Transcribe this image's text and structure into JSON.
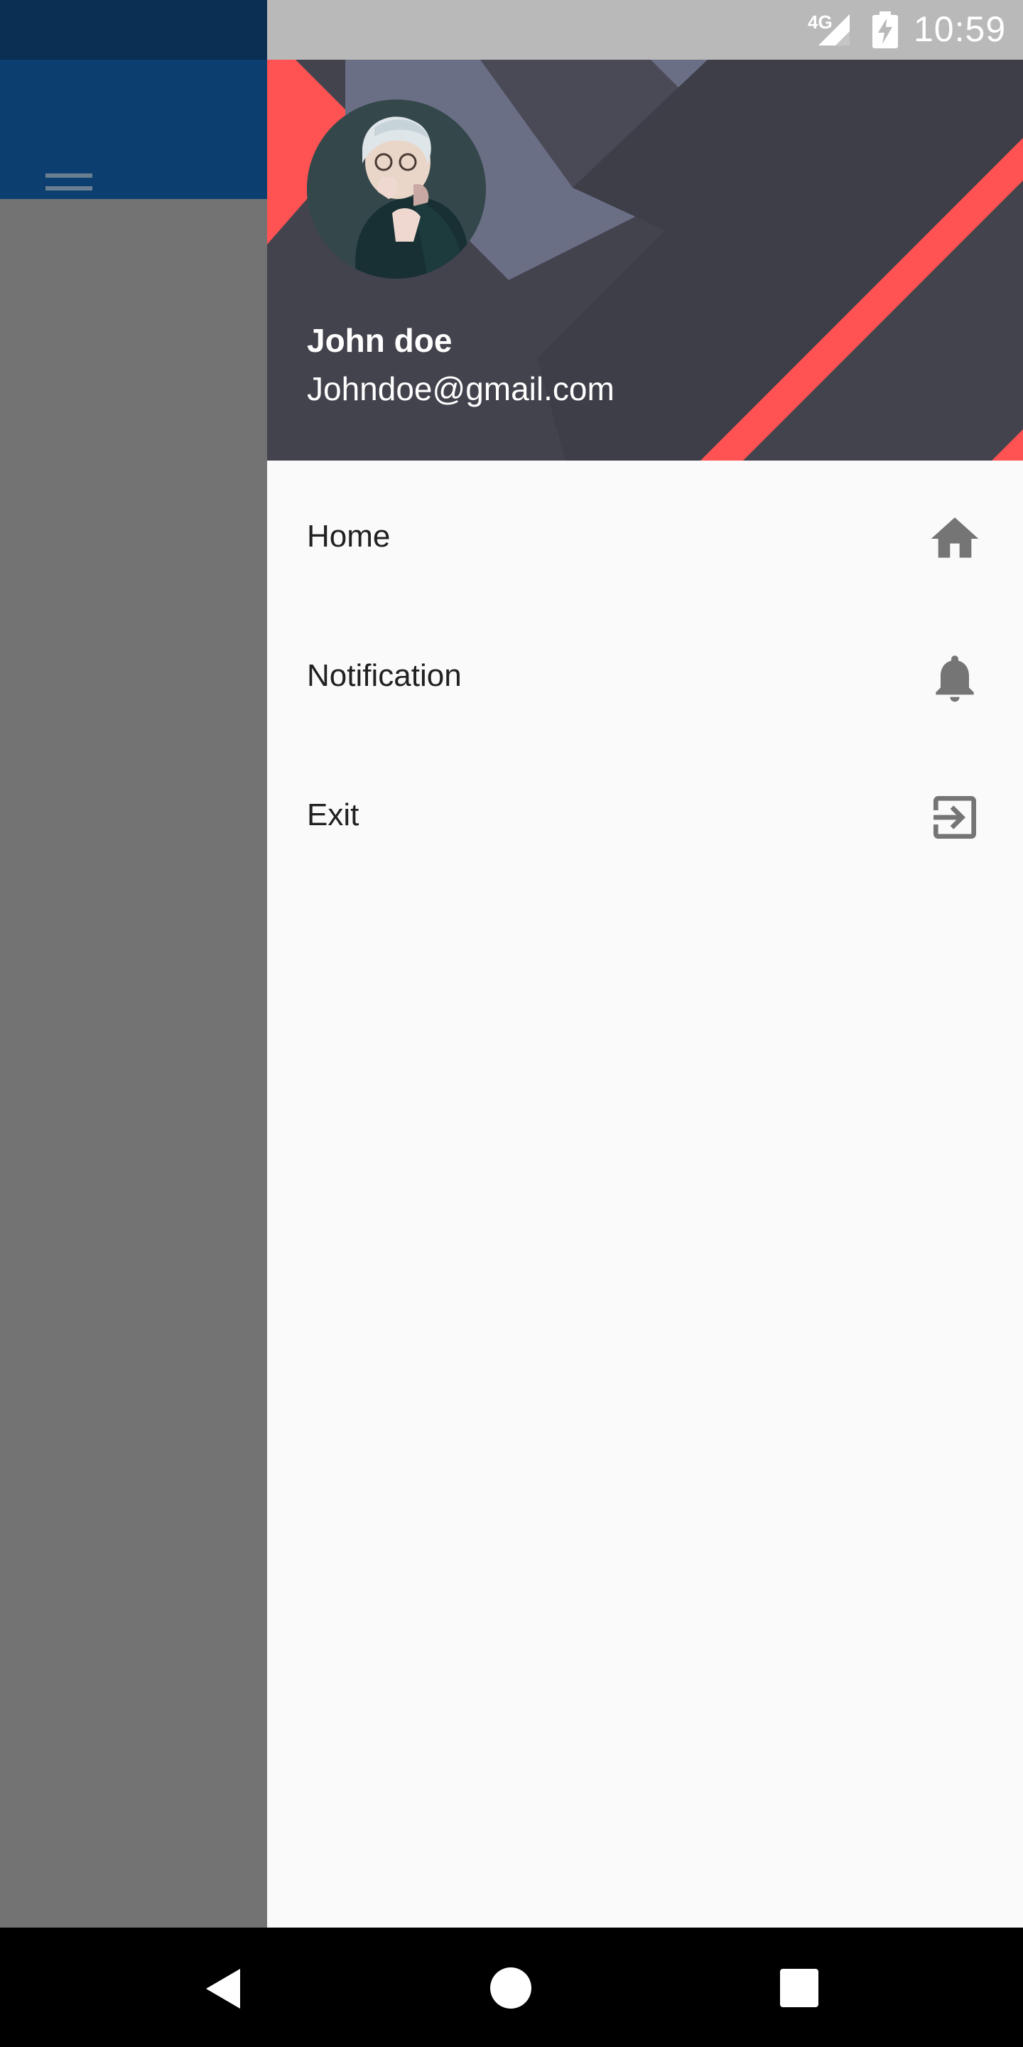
{
  "status_bar": {
    "network": "4G",
    "time": "10:59"
  },
  "header": {
    "user_name": "John doe",
    "user_email": "Johndoe@gmail.com"
  },
  "menu": {
    "items": [
      {
        "label": "Home",
        "icon": "home-icon"
      },
      {
        "label": "Notification",
        "icon": "bell-icon"
      },
      {
        "label": "Exit",
        "icon": "exit-icon"
      }
    ]
  },
  "colors": {
    "app_bar": "#0c3f6f",
    "header_bg": "#43434d",
    "accent_red": "#ff5252",
    "drawer_bg": "#fafafa"
  }
}
